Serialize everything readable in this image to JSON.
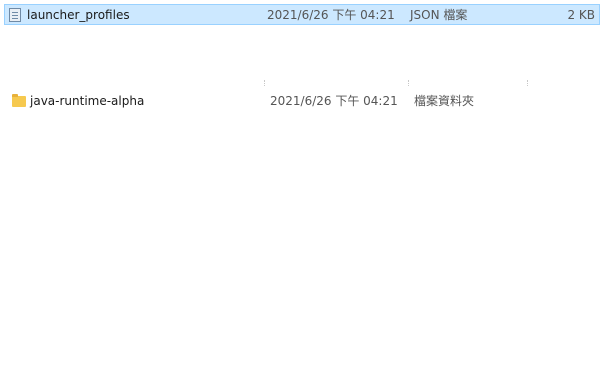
{
  "files": [
    {
      "name": "launcher_profiles",
      "date_modified": "2021/6/26 下午 04:21",
      "type": "JSON 檔案",
      "size": "2 KB",
      "icon": "json-file-icon",
      "selected": true
    },
    {
      "name": "java-runtime-alpha",
      "date_modified": "2021/6/26 下午 04:21",
      "type": "檔案資料夾",
      "size": "",
      "icon": "folder-icon",
      "selected": false
    }
  ],
  "colors": {
    "selection_bg": "#cce8ff",
    "selection_border": "#99d1ff",
    "folder": "#f6c94f"
  }
}
